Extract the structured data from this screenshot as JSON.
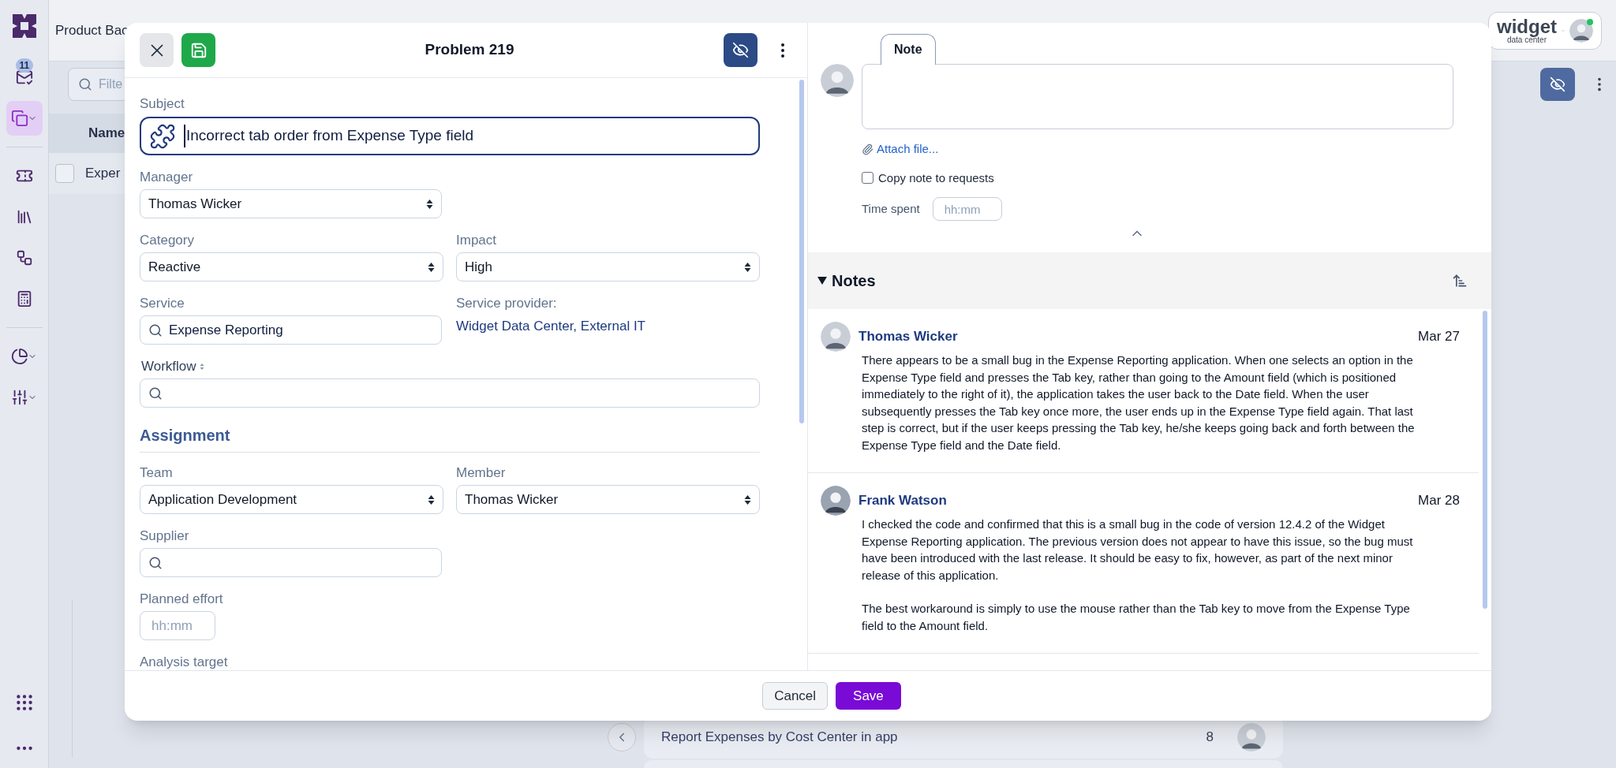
{
  "app": {
    "title": "Product Bac",
    "logo": {
      "name": "widget",
      "tagline": "data center"
    },
    "filter_placeholder": "Filte",
    "column_header": "Name",
    "row": {
      "text": "Exper",
      "checked": false
    },
    "card": {
      "title": "Report Expenses by Cost Center in app",
      "count": "8"
    }
  },
  "sidebar": {
    "items": [
      {
        "badge": "11",
        "selected": false
      },
      {
        "selected": true
      },
      {
        "selected": false
      },
      {
        "selected": false
      },
      {
        "selected": false
      },
      {
        "selected": false
      },
      {
        "selected": false
      },
      {
        "selected": false
      }
    ]
  },
  "modal": {
    "title": "Problem 219",
    "subject": {
      "label": "Subject",
      "value": "Incorrect tab order from Expense Type field"
    },
    "manager": {
      "label": "Manager",
      "value": "Thomas Wicker"
    },
    "category": {
      "label": "Category",
      "value": "Reactive"
    },
    "impact": {
      "label": "Impact",
      "value": "High"
    },
    "service": {
      "label": "Service",
      "value": "Expense Reporting"
    },
    "service_provider": {
      "label": "Service provider:",
      "value": "Widget Data Center, External IT"
    },
    "workflow": {
      "label": "Workflow"
    },
    "assignment": {
      "title": "Assignment"
    },
    "team": {
      "label": "Team",
      "value": "Application Development"
    },
    "member": {
      "label": "Member",
      "value": "Thomas Wicker"
    },
    "supplier": {
      "label": "Supplier"
    },
    "planned_effort": {
      "label": "Planned effort",
      "placeholder": "hh:mm"
    },
    "analysis_target": {
      "label": "Analysis target"
    },
    "note_composer": {
      "tab": "Note",
      "attach": "Attach file...",
      "copy_to_requests": {
        "label": "Copy note to requests",
        "checked": false
      },
      "time_spent": {
        "label": "Time spent",
        "placeholder": "hh:mm"
      }
    },
    "notes": {
      "title": "Notes",
      "expanded": true,
      "items": [
        {
          "author": "Thomas Wicker",
          "date": "Mar 27",
          "paragraphs": [
            "There appears to be a small bug in the Expense Reporting application. When one selects an option in the Expense Type field and presses the Tab key, rather than going to the Amount field (which is positioned immediately to the right of it), the application takes the user back to the Date field. When the user subsequently presses the Tab key once more, the user ends up in the Expense Type field again. That last step is correct, but if the user keeps pressing the Tab key, he/she keeps going back and forth between the Expense Type field and the Date field."
          ]
        },
        {
          "author": "Frank Watson",
          "date": "Mar 28",
          "paragraphs": [
            "I checked the code and confirmed that this is a small bug in the code of version 12.4.2 of the Widget Expense Reporting application. The previous version does not appear to have this issue, so the bug must have been introduced with the last release. It should be easy to fix, however, as part of the next minor release of this application.",
            "The best workaround is simply to use the mouse rather than the Tab key to move from the Expense Type field to the Amount field."
          ]
        }
      ]
    },
    "buttons": {
      "cancel": "Cancel",
      "save": "Save"
    }
  }
}
